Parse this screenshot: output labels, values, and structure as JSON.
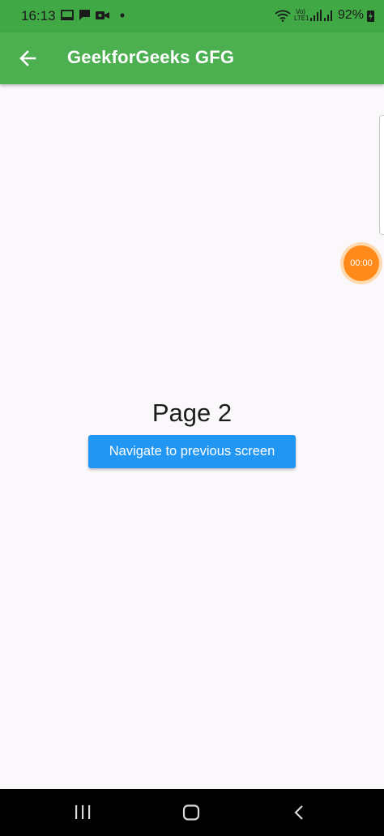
{
  "status_bar": {
    "time": "16:13",
    "battery": "92%",
    "lte_top": "Vo)",
    "lte_bottom": "LTE1",
    "icons": [
      "screen-cast-icon",
      "message-icon",
      "video-camera-icon",
      "dot-icon",
      "wifi-icon",
      "signal-icon",
      "battery-charging-icon"
    ]
  },
  "app_bar": {
    "title": "GeekforGeeks GFG",
    "back_icon": "arrow-back-icon",
    "color": "#4caf50"
  },
  "timer": {
    "text": "00:00",
    "color": "#ff8a1a"
  },
  "content": {
    "page_label": "Page 2",
    "button_label": "Navigate to previous screen",
    "button_color": "#2196f3"
  },
  "nav_bar": {
    "keys": [
      "recents-icon",
      "home-icon",
      "back-icon"
    ]
  }
}
